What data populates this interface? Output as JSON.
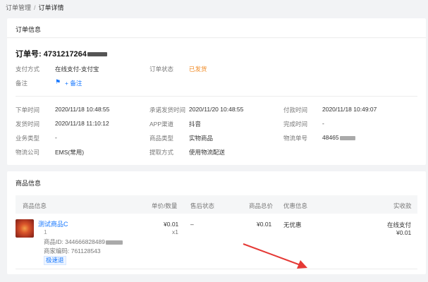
{
  "breadcrumb": {
    "parent": "订单管理",
    "separator": "/",
    "current": "订单详情"
  },
  "order_info": {
    "title": "订单信息",
    "order_no_label": "订单号:",
    "order_no_visible": "4731217264",
    "rows": {
      "pay_method_label": "支付方式",
      "pay_method": "在线支付-支付宝",
      "order_status_label": "订单状态",
      "order_status": "已发货",
      "remark_label": "备注",
      "remark_action": "+ 备注",
      "order_time_label": "下单时间",
      "order_time": "2020/11/18 10:48:55",
      "promise_ship_label": "承诺发货时间",
      "promise_ship": "2020/11/20 10:48:55",
      "pay_time_label": "付款时间",
      "pay_time": "2020/11/18 10:49:07",
      "ship_time_label": "发货时间",
      "ship_time": "2020/11/18 11:10:12",
      "app_channel_label": "APP渠道",
      "app_channel": "抖音",
      "finish_time_label": "完成时间",
      "finish_time": "-",
      "biz_type_label": "业务类型",
      "biz_type": "-",
      "goods_type_label": "商品类型",
      "goods_type": "实物商品",
      "logistics_no_label": "物流单号",
      "logistics_no_visible": "48465",
      "logistics_co_label": "物流公司",
      "logistics_co": "EMS(常用)",
      "pickup_label": "提取方式",
      "pickup": "使用物流配送"
    }
  },
  "goods_info": {
    "title": "商品信息",
    "columns": [
      "商品信息",
      "单价/数量",
      "售后状态",
      "商品总价",
      "优惠信息",
      "实收款"
    ],
    "item": {
      "name": "测试商品C",
      "qty_small": "1",
      "id_label": "商品ID: 344666828489",
      "code_label": "商家编码: 761128543",
      "tag": "极速退",
      "unit_price": "¥0.01",
      "qty": "x1",
      "after_sale": "–",
      "total": "¥0.01",
      "discount": "无优惠",
      "paid_method": "在线支付",
      "paid_amount": "¥0.01"
    }
  },
  "colors": {
    "link": "#1677ff",
    "status_orange": "#f08a24",
    "annotation_arrow": "#e53935"
  }
}
